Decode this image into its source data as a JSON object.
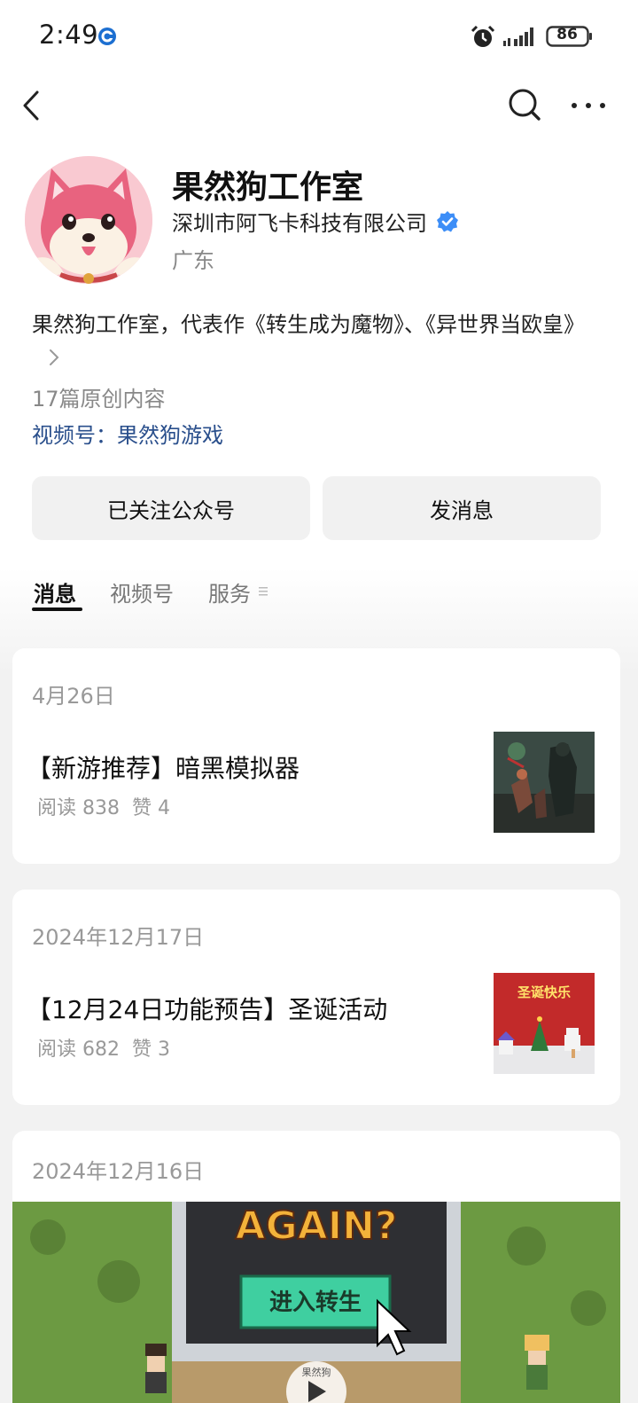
{
  "status_bar": {
    "time": "2:49",
    "battery": "86"
  },
  "profile": {
    "name": "果然狗工作室",
    "company": "深圳市阿飞卡科技有限公司",
    "region": "广东",
    "bio": "果然狗工作室，代表作《转生成为魔物》、《异世界当欧皇》",
    "original_count": "17篇原创内容",
    "channel_label": "视频号：",
    "channel_name": "果然狗游戏"
  },
  "actions": {
    "follow": "已关注公众号",
    "message": "发消息"
  },
  "tabs": [
    {
      "label": "消息",
      "active": true
    },
    {
      "label": "视频号",
      "active": false
    },
    {
      "label": "服务",
      "active": false
    }
  ],
  "posts": [
    {
      "date": "4月26日",
      "title": "【新游推荐】暗黑模拟器",
      "reads": "阅读 838",
      "likes": "赞 4"
    },
    {
      "date": "2024年12月17日",
      "title": "【12月24日功能预告】圣诞活动",
      "reads": "阅读 682",
      "likes": "赞 3",
      "thumb_text": "圣诞快乐"
    },
    {
      "date": "2024年12月16日",
      "video_text": "AGAIN?",
      "video_button": "进入转生",
      "video_watermark": "果然狗"
    }
  ],
  "colors": {
    "link": "#2a4f8c",
    "verified": "#3d8ef7",
    "page_bg": "#f2f2f2"
  },
  "icons": [
    "app-notification-icon",
    "alarm-icon",
    "signal-icon",
    "battery-icon",
    "back-icon",
    "search-icon",
    "more-icon",
    "verified-icon",
    "chevron-right-icon",
    "play-icon"
  ]
}
